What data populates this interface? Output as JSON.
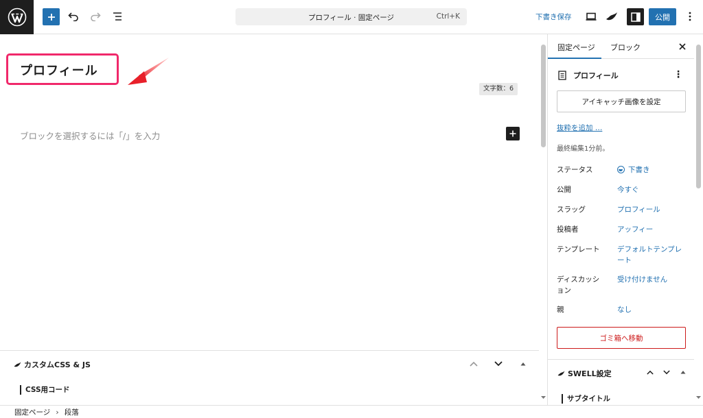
{
  "topbar": {
    "document_title": "プロフィール · 固定ページ",
    "shortcut": "Ctrl+K",
    "save_draft_label": "下書き保存",
    "publish_label": "公開",
    "icons": [
      "wordpress-logo",
      "plus-icon",
      "undo-icon",
      "redo-icon",
      "document-overview-icon",
      "desktop-preview-icon",
      "swell-icon",
      "settings-sidebar-icon",
      "more-vertical-icon"
    ]
  },
  "editor": {
    "post_title": "プロフィール",
    "char_count": "文字数：6",
    "placeholder": "ブロックを選択するには「/」を入力",
    "annotation_color": "#f0286a"
  },
  "metabox": {
    "title": "カスタムCSS & JS",
    "css_label": "CSS用コード"
  },
  "footer": {
    "breadcrumb": [
      "固定ページ",
      "段落"
    ]
  },
  "sidebar": {
    "tabs": [
      "固定ページ",
      "ブロック"
    ],
    "active_tab": "固定ページ",
    "page_title": "プロフィール",
    "featured_image_button": "アイキャッチ画像を設定",
    "excerpt_link": "抜粋を追加 …",
    "last_edited": "最終編集1分前。",
    "rows": [
      {
        "label": "ステータス",
        "value": "下書き"
      },
      {
        "label": "公開",
        "value": "今すぐ"
      },
      {
        "label": "スラッグ",
        "value": "プロフィール"
      },
      {
        "label": "投稿者",
        "value": "アッフィー"
      },
      {
        "label": "テンプレート",
        "value": "デフォルトテンプレート"
      },
      {
        "label": "ディスカッション",
        "value": "受け付けません"
      },
      {
        "label": "親",
        "value": "なし"
      }
    ],
    "trash_button": "ゴミ箱へ移動",
    "swell_title": "SWELL設定",
    "subtitle_label": "サブタイトル"
  },
  "colors": {
    "accent": "#2271b1",
    "danger": "#cc1818",
    "dark": "#1e1e1e"
  }
}
